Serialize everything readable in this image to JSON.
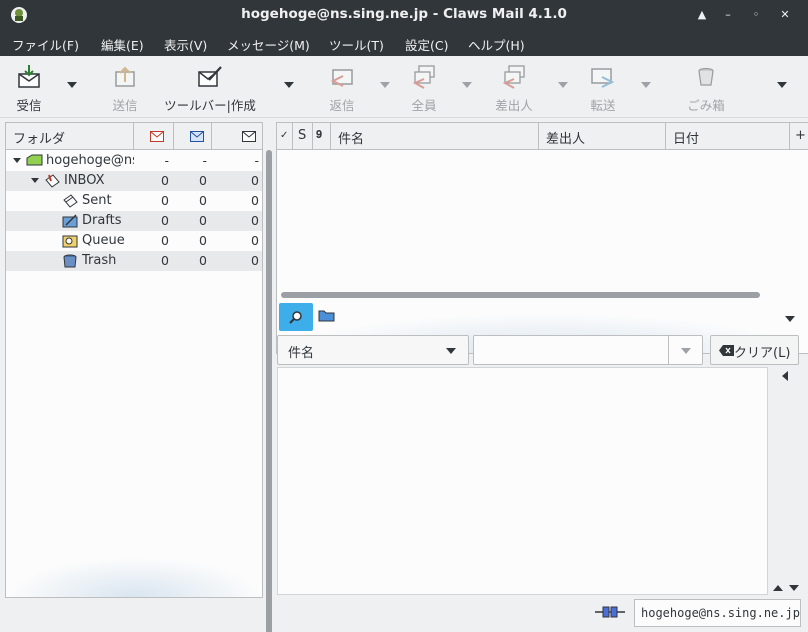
{
  "window": {
    "title": "hogehoge@ns.sing.ne.jp - Claws Mail 4.1.0",
    "controls": [
      "▲",
      "–",
      "◦",
      "✕"
    ]
  },
  "menubar": {
    "items": [
      "ファイル(F)",
      "編集(E)",
      "表示(V)",
      "メッセージ(M)",
      "ツール(T)",
      "設定(C)",
      "ヘルプ(H)"
    ]
  },
  "toolbar": {
    "receive": "受信",
    "send": "送信",
    "compose": "ツールバー|作成",
    "reply": "返信",
    "reply_all": "全員",
    "reply_sender": "差出人",
    "forward": "転送",
    "trash": "ごみ箱"
  },
  "folder_pane": {
    "header": {
      "folder": "フォルダ"
    },
    "rows": [
      {
        "name": "hogehoge@ns",
        "icon": "mailbox-icon",
        "new": "-",
        "unread": "-",
        "total": "-"
      },
      {
        "name": "INBOX",
        "icon": "inbox-icon",
        "new": "0",
        "unread": "0",
        "total": "0"
      },
      {
        "name": "Sent",
        "icon": "sent-icon",
        "new": "0",
        "unread": "0",
        "total": "0"
      },
      {
        "name": "Drafts",
        "icon": "drafts-icon",
        "new": "0",
        "unread": "0",
        "total": "0"
      },
      {
        "name": "Queue",
        "icon": "queue-icon",
        "new": "0",
        "unread": "0",
        "total": "0"
      },
      {
        "name": "Trash",
        "icon": "trash-icon",
        "new": "0",
        "unread": "0",
        "total": "0"
      }
    ]
  },
  "message_list": {
    "columns": {
      "mark": "✓",
      "status": "S",
      "attach": "𝟗",
      "subject": "件名",
      "from": "差出人",
      "date": "日付",
      "more": "+"
    }
  },
  "quick_search": {
    "type_value": "件名",
    "input_value": "",
    "clear_label": "クリア(L)"
  },
  "statusbar": {
    "account": "hogehoge@ns.sing.ne.jp"
  },
  "colors": {
    "dark": "#31363b",
    "window_bg": "#eff0f1",
    "accent": "#3daee9"
  }
}
